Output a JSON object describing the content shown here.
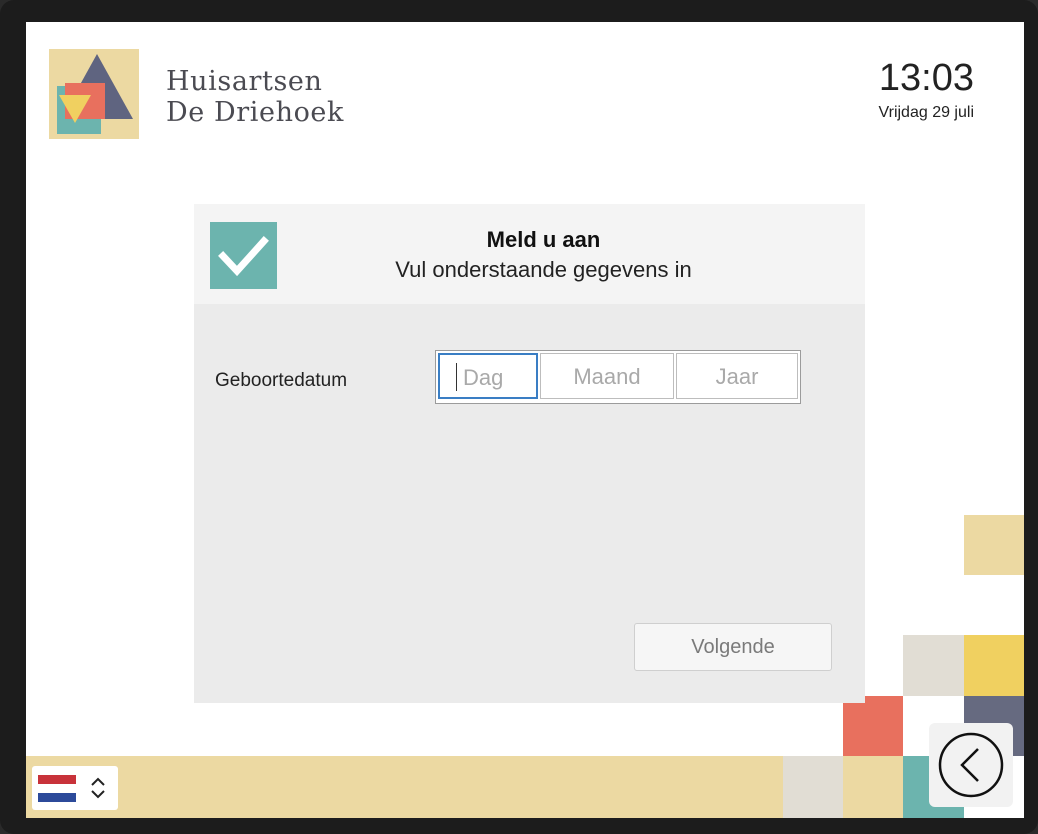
{
  "header": {
    "brand_line1": "Huisartsen",
    "brand_line2": "De Driehoek",
    "time": "13:03",
    "date": "Vrijdag 29 juli"
  },
  "card": {
    "title": "Meld u aan",
    "subtitle": "Vul onderstaande gegevens in",
    "dob_label": "Geboortedatum",
    "fields": {
      "day_placeholder": "Dag",
      "month_placeholder": "Maand",
      "year_placeholder": "Jaar"
    },
    "next_label": "Volgende"
  },
  "colors": {
    "teal": "#6cb4ae",
    "sand": "#ecd9a2",
    "yellow": "#f0d060",
    "coral": "#e8705e",
    "slate": "#666a80",
    "stone": "#e1ddd4",
    "focus_blue": "#3a7ec4"
  },
  "icons": {
    "check": "check-icon",
    "language": "netherlands-flag-icon",
    "back": "back-arrow-icon"
  }
}
